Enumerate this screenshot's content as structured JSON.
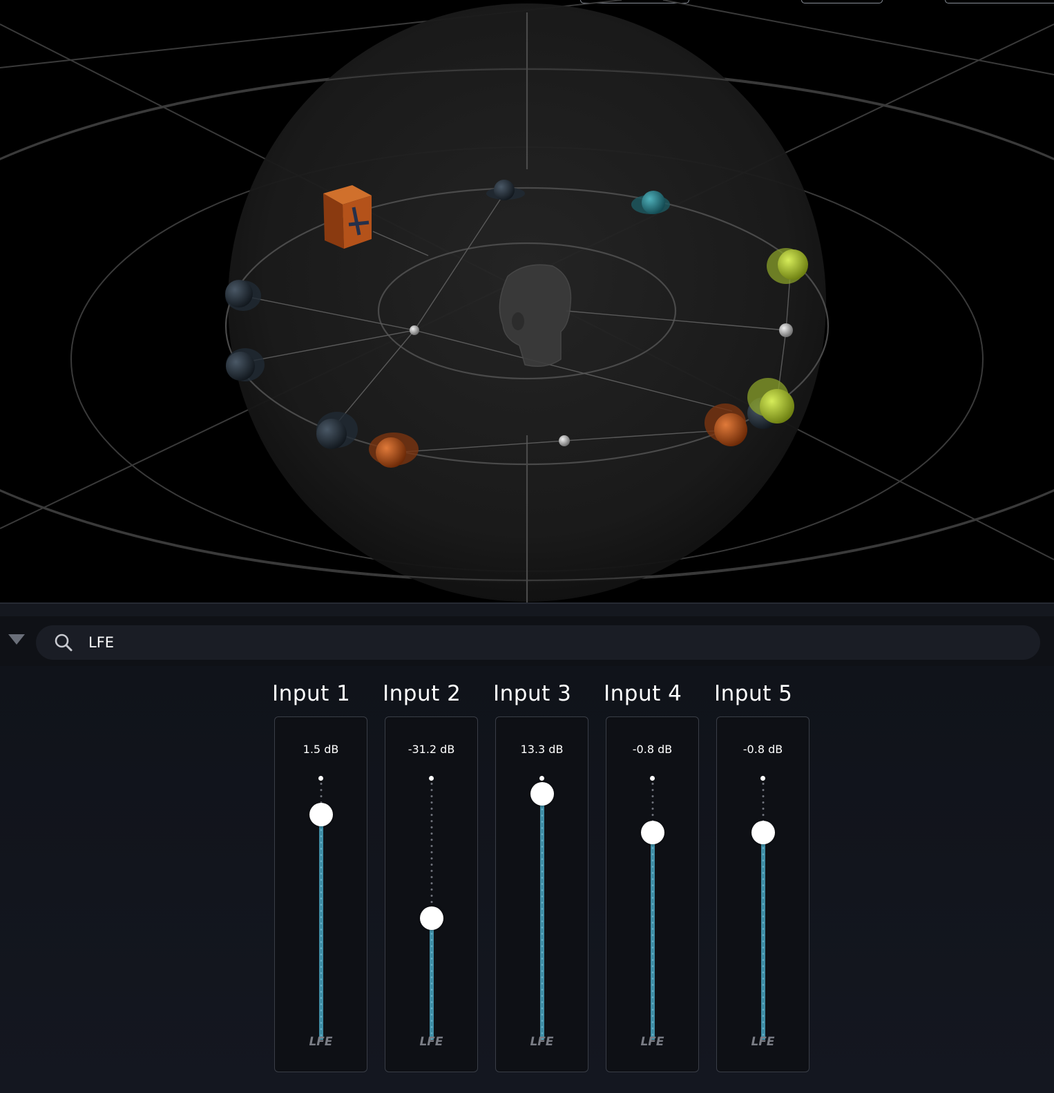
{
  "filter": {
    "search_value": "LFE"
  },
  "colors": {
    "accent": "#3f8ea6",
    "knob": "#ffffff",
    "speaker_orange": "#b4521a",
    "speaker_green": "#a9c234",
    "speaker_teal": "#2a7f8a",
    "speaker_dark": "#2b3440"
  },
  "strips": [
    {
      "title": "Input 1",
      "value": "1.5 dB",
      "level": 0.87,
      "label": "LFE"
    },
    {
      "title": "Input 2",
      "value": "-31.2 dB",
      "level": 0.47,
      "label": "LFE"
    },
    {
      "title": "Input 3",
      "value": "13.3 dB",
      "level": 0.95,
      "label": "LFE"
    },
    {
      "title": "Input 4",
      "value": "-0.8 dB",
      "level": 0.8,
      "label": "LFE"
    },
    {
      "title": "Input 5",
      "value": "-0.8 dB",
      "level": 0.8,
      "label": "LFE"
    }
  ]
}
